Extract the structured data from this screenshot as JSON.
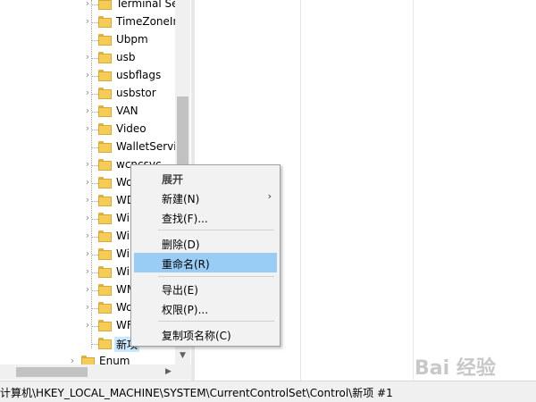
{
  "tree": {
    "items": [
      {
        "label": "Terminal Se",
        "expandable": true
      },
      {
        "label": "TimeZoneIn",
        "expandable": true
      },
      {
        "label": "Ubpm",
        "expandable": false
      },
      {
        "label": "usb",
        "expandable": true
      },
      {
        "label": "usbflags",
        "expandable": true
      },
      {
        "label": "usbstor",
        "expandable": true
      },
      {
        "label": "VAN",
        "expandable": true
      },
      {
        "label": "Video",
        "expandable": true
      },
      {
        "label": "WalletServi",
        "expandable": false
      },
      {
        "label": "wcncsvc",
        "expandable": true
      },
      {
        "label": "Wo",
        "expandable": true
      },
      {
        "label": "WD",
        "expandable": true
      },
      {
        "label": "Wi",
        "expandable": true
      },
      {
        "label": "Wi",
        "expandable": true
      },
      {
        "label": "Wi",
        "expandable": true
      },
      {
        "label": "Wi",
        "expandable": true
      },
      {
        "label": "WM",
        "expandable": true
      },
      {
        "label": "Wo",
        "expandable": true
      },
      {
        "label": "WF",
        "expandable": true
      },
      {
        "label": "新项",
        "expandable": false,
        "selected": true
      }
    ],
    "enum_label": "Enum"
  },
  "context_menu": {
    "items": [
      {
        "label": "展开",
        "bold": true
      },
      {
        "label": "新建(N)",
        "submenu": true
      },
      {
        "label": "查找(F)..."
      },
      {
        "label": "删除(D)"
      },
      {
        "label": "重命名(R)",
        "highlight": true
      },
      {
        "label": "导出(E)"
      },
      {
        "label": "权限(P)..."
      },
      {
        "label": "复制项名称(C)"
      }
    ],
    "submenu_arrow": "›"
  },
  "statusbar": {
    "path": "计算机\\HKEY_LOCAL_MACHINE\\SYSTEM\\CurrentControlSet\\Control\\新项 #1"
  },
  "watermark": {
    "text": "Bai 经验"
  },
  "colors": {
    "folder": "#f5cd56",
    "menu_highlight": "#99cdf5",
    "selection": "#cce8ff"
  }
}
